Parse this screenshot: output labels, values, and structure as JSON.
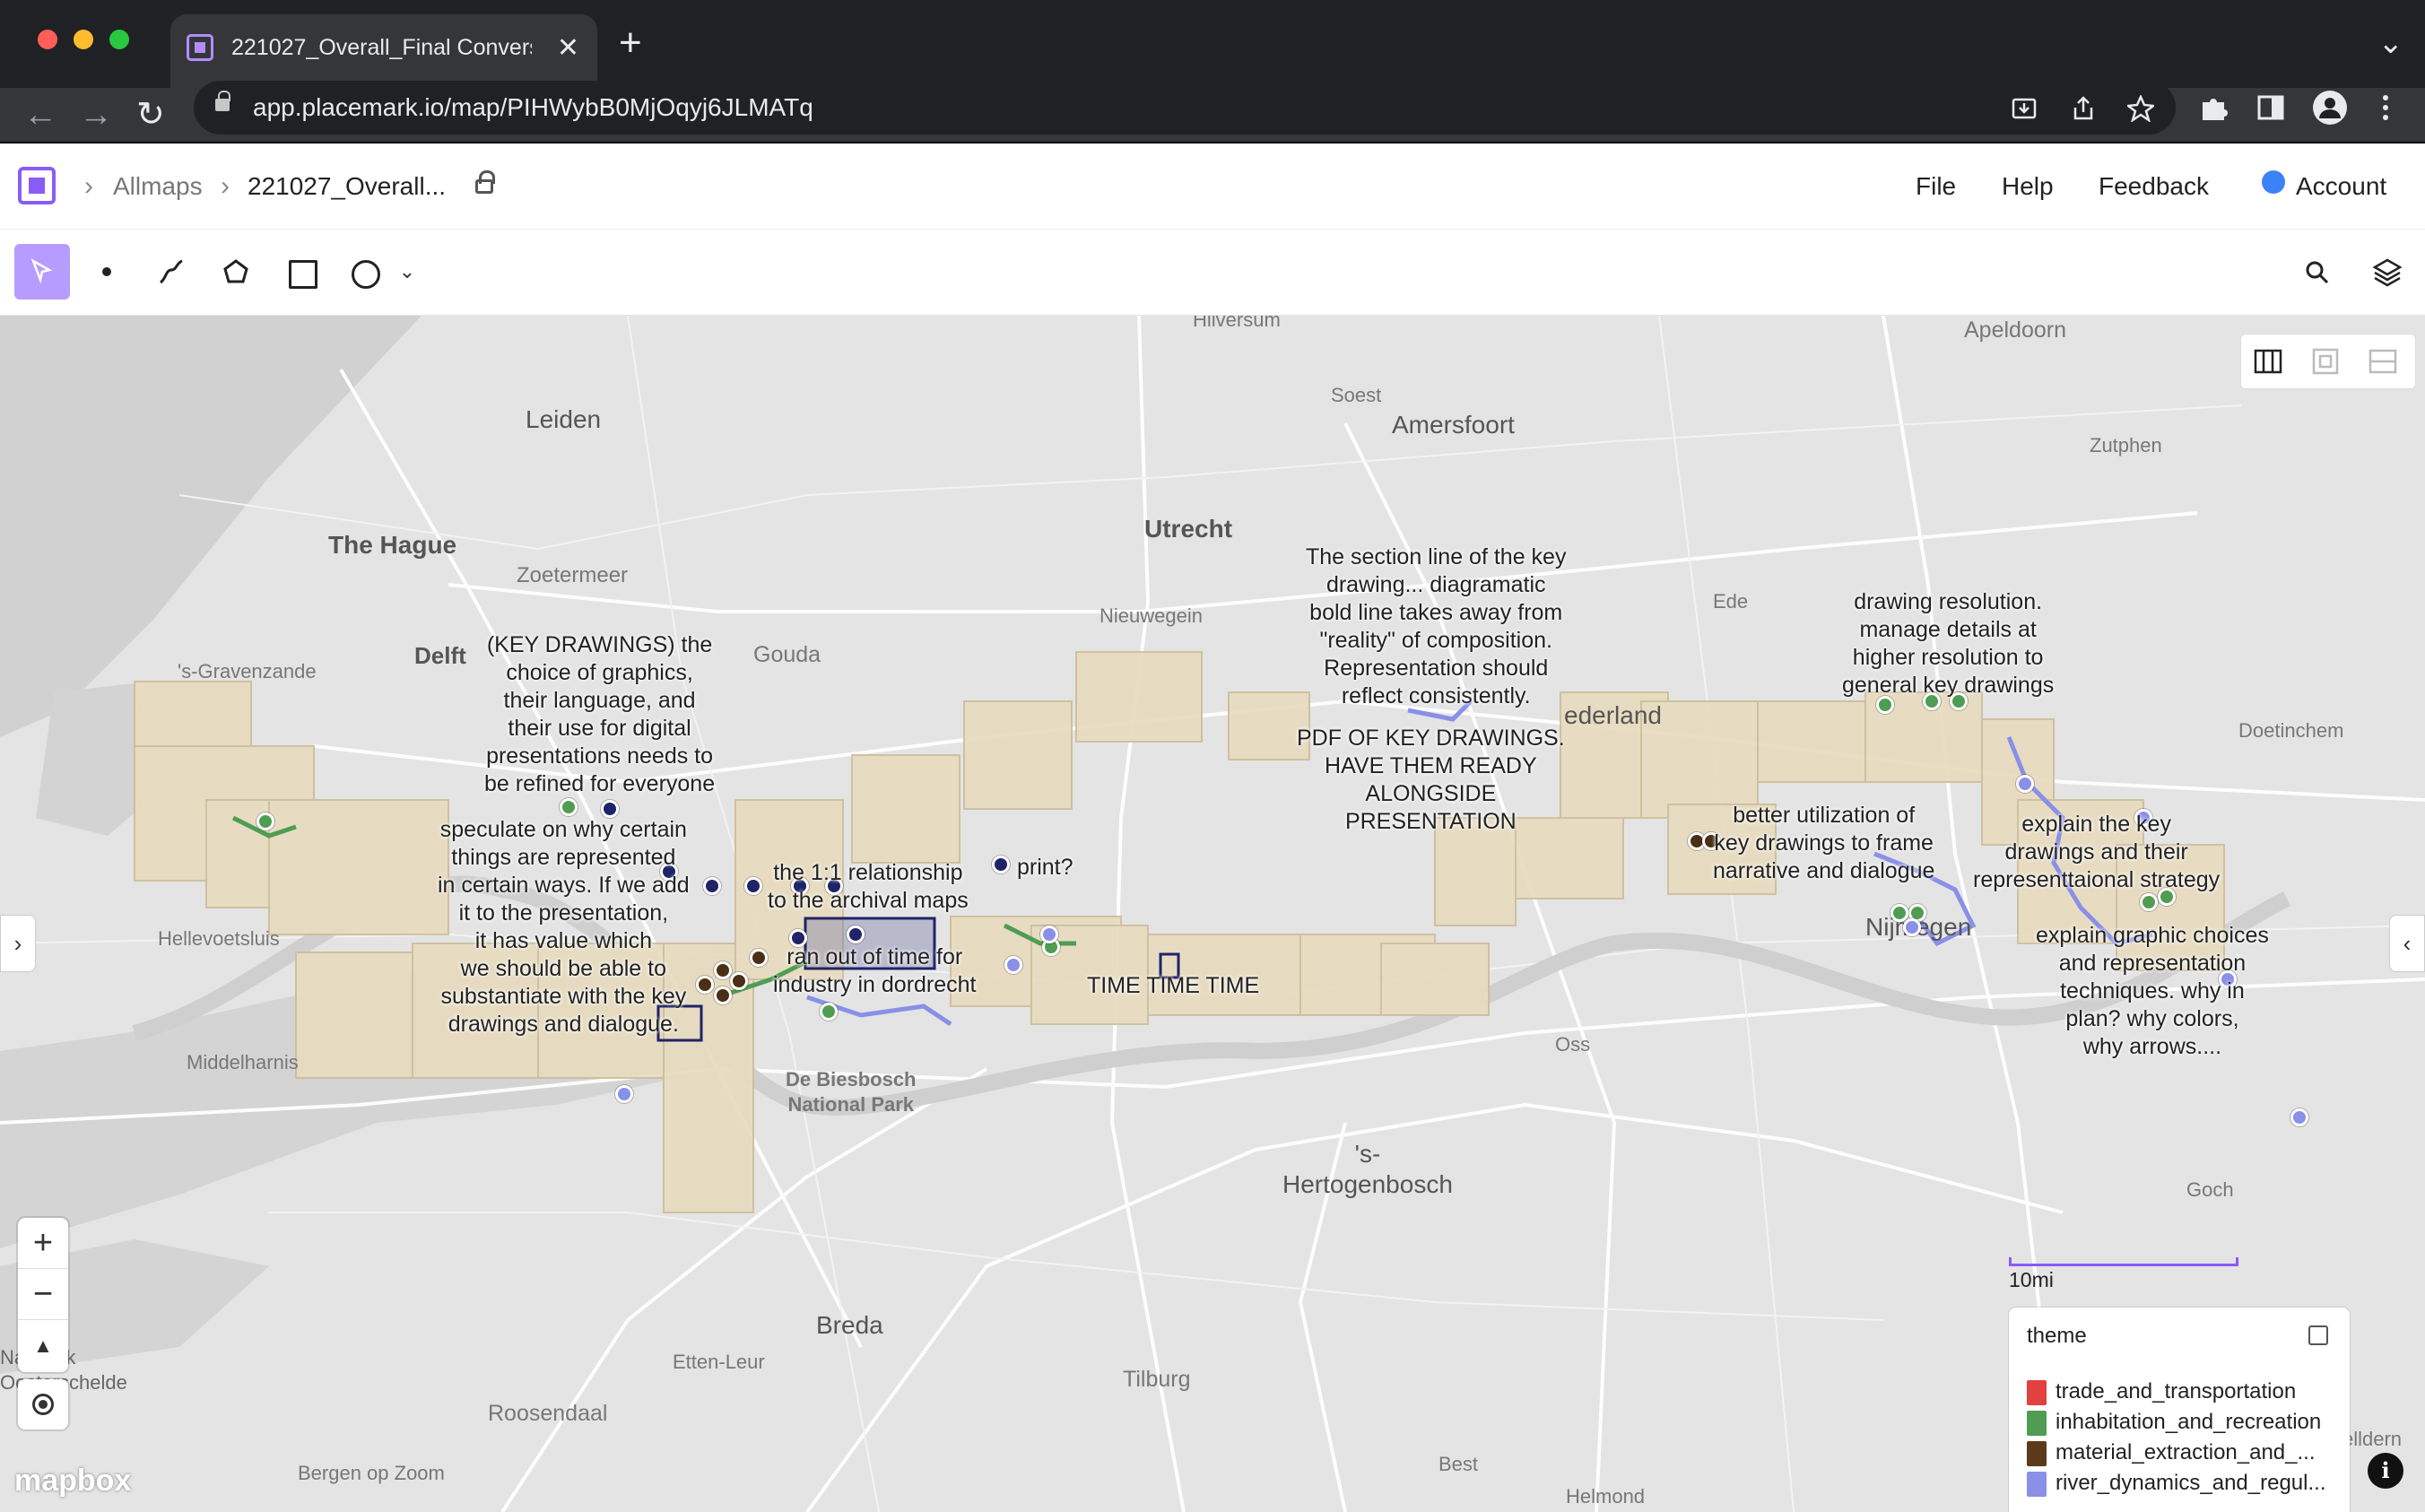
{
  "browser": {
    "tab_title": "221027_Overall_Final Conversa",
    "tab_close": "✕",
    "new_tab": "+",
    "tabs_menu": "⌄",
    "url": "app.placemark.io/map/PIHWybB0MjOqyj6JLMATq",
    "back": "←",
    "forward": "→",
    "reload": "↻",
    "extension_icons": [
      "download-icon",
      "share-icon",
      "star-icon",
      "puzzle-icon",
      "sidebar-icon",
      "profile-icon",
      "kebab-icon"
    ],
    "colors": {
      "chrome_dark": "#202124",
      "chrome_tab": "#35363a"
    }
  },
  "app": {
    "breadcrumb": {
      "root": "Allmaps",
      "current": "221027_Overall..."
    },
    "menu": {
      "file": "File",
      "help": "Help",
      "feedback": "Feedback",
      "account": "Account"
    },
    "accent": "#8a5cf6",
    "tools": [
      "select",
      "point",
      "line",
      "polygon",
      "rectangle",
      "circle",
      "more"
    ]
  },
  "map": {
    "places": {
      "hilversum": "Hilversum",
      "apeldoorn": "Apeldoorn",
      "leiden": "Leiden",
      "soest": "Soest",
      "amersfoort": "Amersfoort",
      "zutphen": "Zutphen",
      "the_hague": "The Hague",
      "utrecht": "Utrecht",
      "zoetermeer": "Zoetermeer",
      "nieuwegein": "Nieuwegein",
      "ede": "Ede",
      "delft": "Delft",
      "gouda": "Gouda",
      "gravenzande": "'s-Gravenzande",
      "doetinchem": "Doetinchem",
      "nederland": "ederland",
      "nijmegen": "Nijmegen",
      "hellevoetsluis": "Hellevoetsluis",
      "middelharnis": "Middelharnis",
      "biesbosch": "De Biesbosch\nNational Park",
      "oss": "Oss",
      "hertogenbosch": "'s-\nHertogenbosch",
      "goch": "Goch",
      "breda": "Breda",
      "etten_leur": "Etten-Leur",
      "tilburg": "Tilburg",
      "roosendaal": "Roosendaal",
      "bergen_op_zoom": "Bergen op Zoom",
      "best": "Best",
      "helmond": "Helmond",
      "national_park": "Nal Park\nOosterschelde",
      "kleve": "elldern"
    },
    "notes": {
      "key_drawings": "(KEY DRAWINGS) the\nchoice of graphics,\ntheir language, and\ntheir use for digital\npresentations needs to\nbe refined for everyone",
      "speculate": "speculate on why certain\nthings are represented\nin certain ways. If we add\nit to the presentation,\nit has value which\nwe should be able to\nsubstantiate with the key\ndrawings and dialogue.",
      "relationship": "the 1:1 relationship\nto the archival maps",
      "print": "print?",
      "ran_out": "ran out of time for\nindustry in dordrecht",
      "time": "TIME TIME TIME",
      "section_line": "The section line of the key\ndrawing... diagramatic\nbold line takes away from\n\"reality\" of composition.\nRepresentation should\nreflect consistently.",
      "pdf": "PDF OF KEY DRAWINGS.\nHAVE THEM READY\nALONGSIDE\nPRESENTATION",
      "resolution": "drawing resolution.\nmanage details at\nhigher resolution to\ngeneral key drawings",
      "better_util": "better utilization of\nkey drawings to frame\nnarrative and dialogue",
      "explain_key": "explain the key\ndrawings and their\nrepresenttaional strategy",
      "explain_graphic": "explain graphic choices\nand representation\ntechniques. why in\nplan? why colors,\nwhy arrows...."
    },
    "scale_label": "10mi",
    "attribution": "mapbox",
    "zoom_in": "+",
    "zoom_out": "−",
    "compass": "▲",
    "left_tab": "›",
    "right_tab": "‹",
    "info": "i",
    "legend": {
      "title": "theme",
      "items": [
        {
          "label": "trade_and_transportation",
          "color": "#e34040"
        },
        {
          "label": "inhabitation_and_recreation",
          "color": "#4f9d53"
        },
        {
          "label": "material_extraction_and_...",
          "color": "#5a3a1a"
        },
        {
          "label": "river_dynamics_and_regul...",
          "color": "#8a8fe8"
        }
      ]
    }
  }
}
